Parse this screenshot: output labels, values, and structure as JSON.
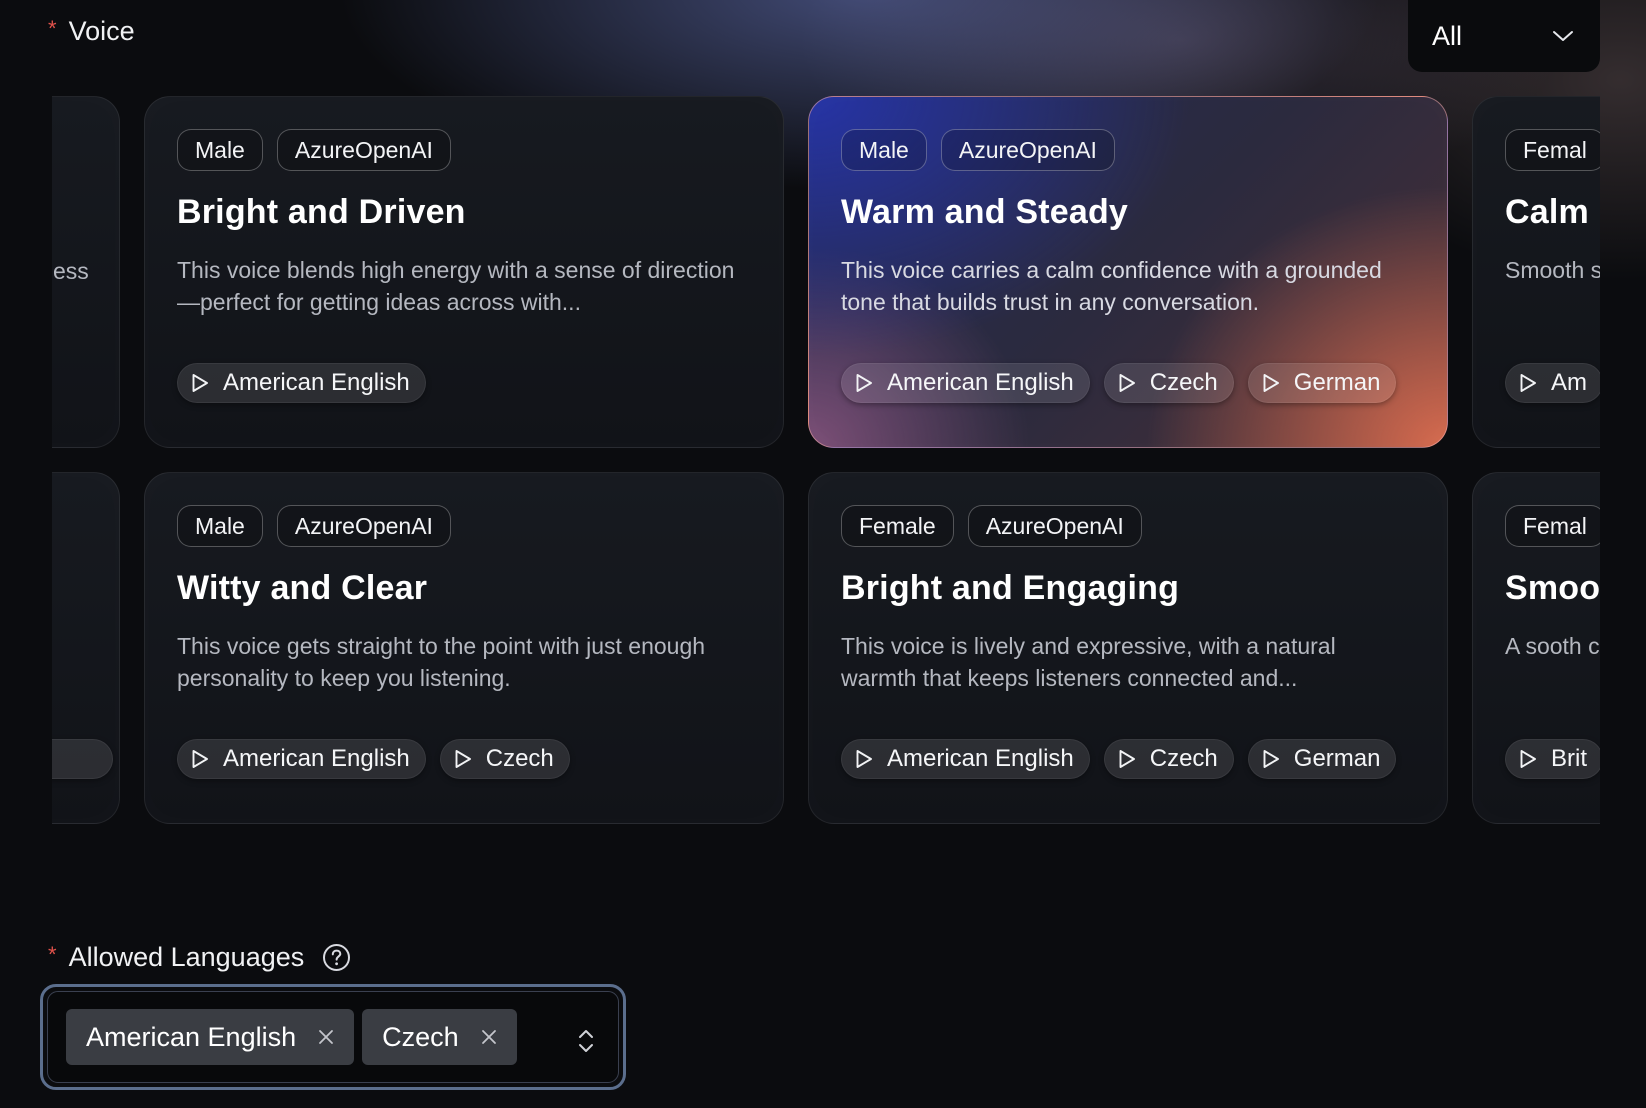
{
  "voice_section": {
    "required_mark": "*",
    "label": "Voice",
    "filter": {
      "selected": "All"
    }
  },
  "cards": [
    {
      "gender": "Male",
      "provider": "AzureOpenAI",
      "title": "Bright and Driven",
      "description": "This voice blends high energy with a sense of direction—perfect for getting ideas across with...",
      "languages": [
        "American English"
      ],
      "selected": false
    },
    {
      "gender": "Male",
      "provider": "AzureOpenAI",
      "title": "Warm and Steady",
      "description": "This voice carries a calm confidence with a grounded tone that builds trust in any conversation.",
      "languages": [
        "American English",
        "Czech",
        "German"
      ],
      "selected": true
    },
    {
      "gender": "Femal",
      "provider": "",
      "title": "Calm",
      "description": "Smooth subtly r",
      "languages": [
        "Am"
      ],
      "selected": false
    },
    {
      "gender": "Male",
      "provider": "AzureOpenAI",
      "title": "Witty and Clear",
      "description": "This voice gets straight to the point with just enough personality to keep you listening.",
      "languages": [
        "American English",
        "Czech"
      ],
      "selected": false
    },
    {
      "gender": "Female",
      "provider": "AzureOpenAI",
      "title": "Bright and Engaging",
      "description": "This voice is lively and expressive, with a natural warmth that keeps listeners connected and...",
      "languages": [
        "American English",
        "Czech",
        "German"
      ],
      "selected": false
    },
    {
      "gender": "Femal",
      "provider": "",
      "title": "Smoo",
      "description": "A sooth calm, cl",
      "languages": [
        "Brit"
      ],
      "selected": false
    }
  ],
  "left_stub_text": "ess",
  "allowed_languages": {
    "required_mark": "*",
    "label": "Allowed Languages",
    "selected": [
      "American English",
      "Czech"
    ]
  },
  "icons": {
    "play": "play-icon",
    "dropdown": "chevron-down-icon",
    "help": "help-circle-icon",
    "remove": "close-icon",
    "sort": "chevron-up-down-icon"
  },
  "colors": {
    "background": "#0b0c0f",
    "required": "#e0524b",
    "focus_ring": "#5b6e8d",
    "chip": "#3a3d43"
  }
}
